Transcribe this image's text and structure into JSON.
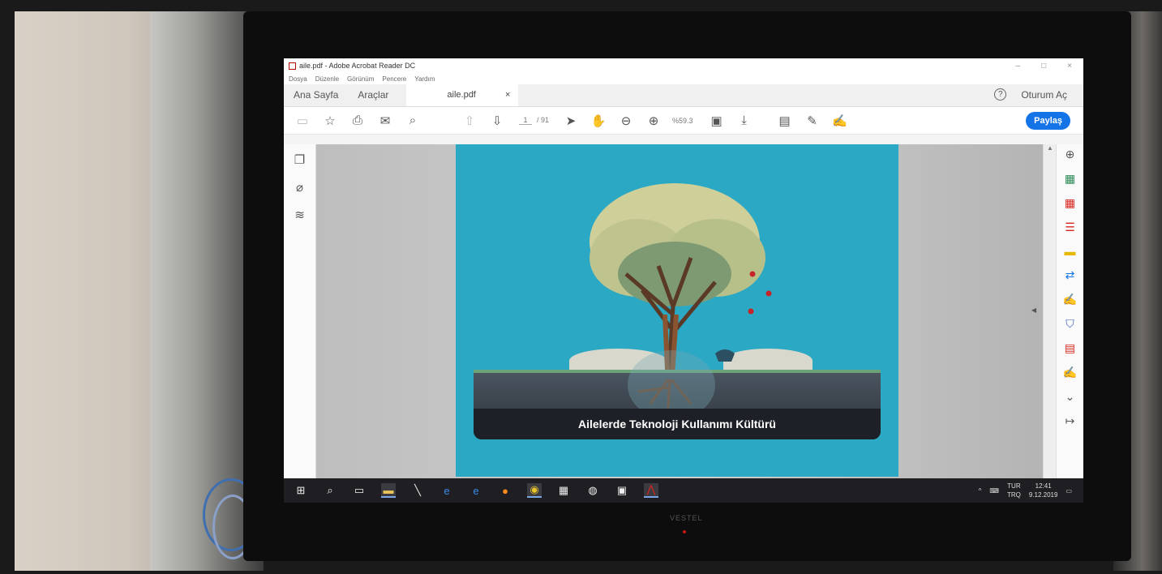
{
  "window": {
    "title": "aile.pdf - Adobe Acrobat Reader DC",
    "controls": [
      "–",
      "□",
      "×"
    ]
  },
  "menu": [
    "Dosya",
    "Düzenle",
    "Görünüm",
    "Pencere",
    "Yardım"
  ],
  "tabs": {
    "home": "Ana Sayfa",
    "tools": "Araçlar",
    "file": "aile.pdf",
    "file_close": "×",
    "help": "?",
    "signin": "Oturum Aç"
  },
  "toolbar": {
    "page_current": "1",
    "page_total": "/ 91",
    "zoom": "%59.3",
    "share_label": "Paylaş"
  },
  "document": {
    "caption": "Ailelerde Teknoloji Kullanımı Kültürü"
  },
  "taskbar": {
    "lang_top": "TUR",
    "lang_bottom": "TRQ",
    "time": "12:41",
    "date": "9.12.2019"
  },
  "bezel": {
    "brand": "VESTEL"
  },
  "colors": {
    "share_blue": "#1473e6",
    "page_bg": "#2aa8c4",
    "acrobat_red": "#d8261f"
  }
}
